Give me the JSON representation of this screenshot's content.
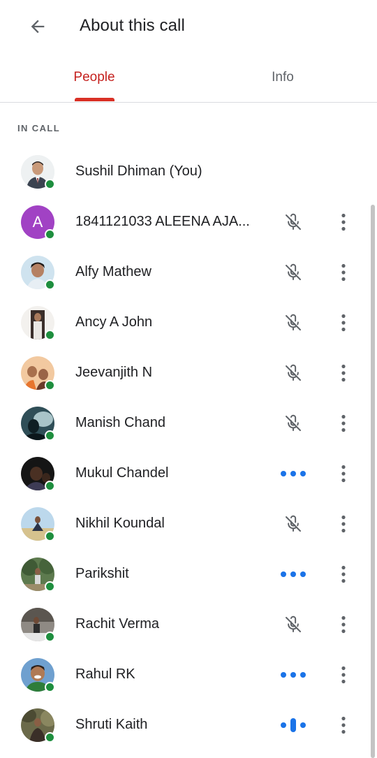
{
  "header": {
    "title": "About this call",
    "back_icon": "arrow-back-icon"
  },
  "tabs": [
    {
      "label": "People",
      "active": true
    },
    {
      "label": "Info",
      "active": false
    }
  ],
  "section_label": "IN CALL",
  "colors": {
    "accent": "#d93025",
    "online": "#1e8e3e",
    "speaking": "#1a73e8",
    "muted_icon": "#5f6368"
  },
  "participants": [
    {
      "name": "Sushil Dhiman (You)",
      "status": "none",
      "avatar": "photo"
    },
    {
      "name": "1841121033 ALEENA AJA...",
      "status": "muted",
      "avatar": "letter",
      "avatar_letter": "A"
    },
    {
      "name": "Alfy Mathew",
      "status": "muted",
      "avatar": "photo"
    },
    {
      "name": "Ancy A John",
      "status": "muted",
      "avatar": "photo"
    },
    {
      "name": "Jeevanjith N",
      "status": "muted",
      "avatar": "photo"
    },
    {
      "name": "Manish Chand",
      "status": "muted",
      "avatar": "photo"
    },
    {
      "name": "Mukul Chandel",
      "status": "unmuted",
      "avatar": "photo"
    },
    {
      "name": "Nikhil Koundal",
      "status": "muted",
      "avatar": "photo"
    },
    {
      "name": "Parikshit",
      "status": "unmuted",
      "avatar": "photo"
    },
    {
      "name": "Rachit Verma",
      "status": "muted",
      "avatar": "photo"
    },
    {
      "name": "Rahul RK",
      "status": "unmuted",
      "avatar": "photo"
    },
    {
      "name": "Shruti Kaith",
      "status": "speaking",
      "avatar": "photo"
    }
  ]
}
